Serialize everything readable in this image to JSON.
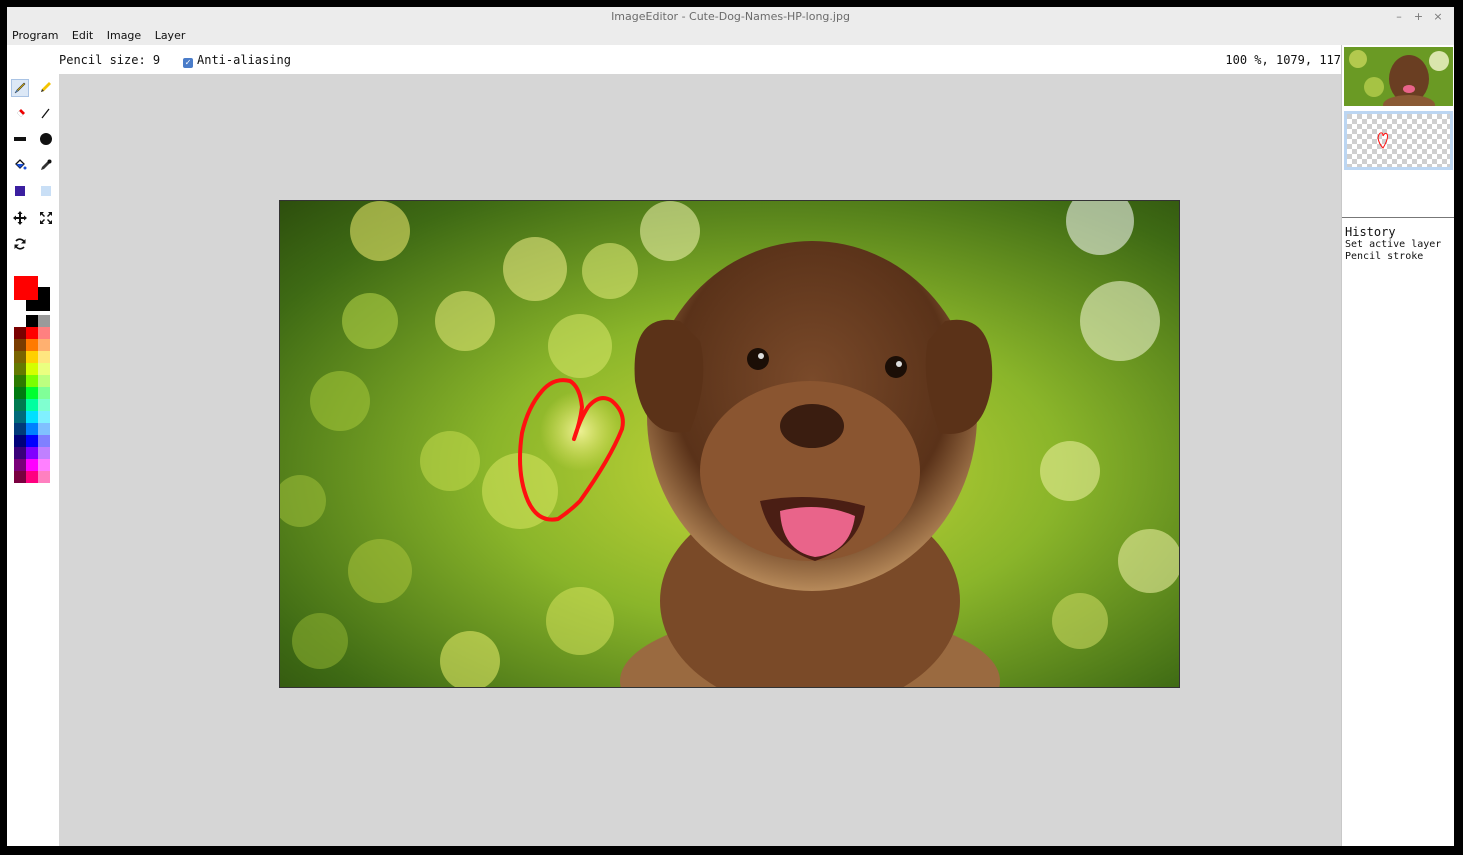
{
  "window": {
    "title": "ImageEditor - Cute-Dog-Names-HP-long.jpg",
    "controls": [
      "–",
      "+",
      "×"
    ]
  },
  "menu": [
    "Program",
    "Edit",
    "Image",
    "Layer"
  ],
  "options": {
    "pencil_size_label": "Pencil size: 9",
    "anti_aliasing_label": "Anti-aliasing",
    "anti_aliasing_checked": true,
    "coords": "100 %, 1079, 117"
  },
  "tools": [
    "brush-icon",
    "pencil-icon",
    "eraser-icon",
    "line-icon",
    "rectangle-icon",
    "ellipse-icon",
    "fill-bucket-icon",
    "color-picker-icon",
    "fill-color-icon",
    "selection-color-icon",
    "move-icon",
    "resize-icon",
    "rotate-icon"
  ],
  "colors": {
    "primary": "#ff0000",
    "secondary": "#000000",
    "palette": [
      [
        "#000000",
        "#9a9a9a"
      ],
      [
        "#7a0000",
        "#ff0000",
        "#ff8080"
      ],
      [
        "#7a3c00",
        "#ff7a00",
        "#ffb070"
      ],
      [
        "#7a6400",
        "#ffd000",
        "#ffe680"
      ],
      [
        "#647a00",
        "#d4ff00",
        "#eaff80"
      ],
      [
        "#2c7a00",
        "#7aff00",
        "#bcff80"
      ],
      [
        "#007a10",
        "#00ff30",
        "#80ff98"
      ],
      [
        "#007a50",
        "#00ffa0",
        "#80ffd0"
      ],
      [
        "#006a7a",
        "#00e0ff",
        "#80f0ff"
      ],
      [
        "#003a7a",
        "#0080ff",
        "#80c0ff"
      ],
      [
        "#00007a",
        "#0000ff",
        "#8080ff"
      ],
      [
        "#3a007a",
        "#8000ff",
        "#c080ff"
      ],
      [
        "#7a007a",
        "#ff00ff",
        "#ff80ff"
      ],
      [
        "#7a0040",
        "#ff0080",
        "#ff80c0"
      ]
    ]
  },
  "layers": [
    "background-image-layer",
    "pencil-layer"
  ],
  "history": {
    "title": "History",
    "items": [
      "Set active layer",
      "Pencil stroke"
    ]
  }
}
